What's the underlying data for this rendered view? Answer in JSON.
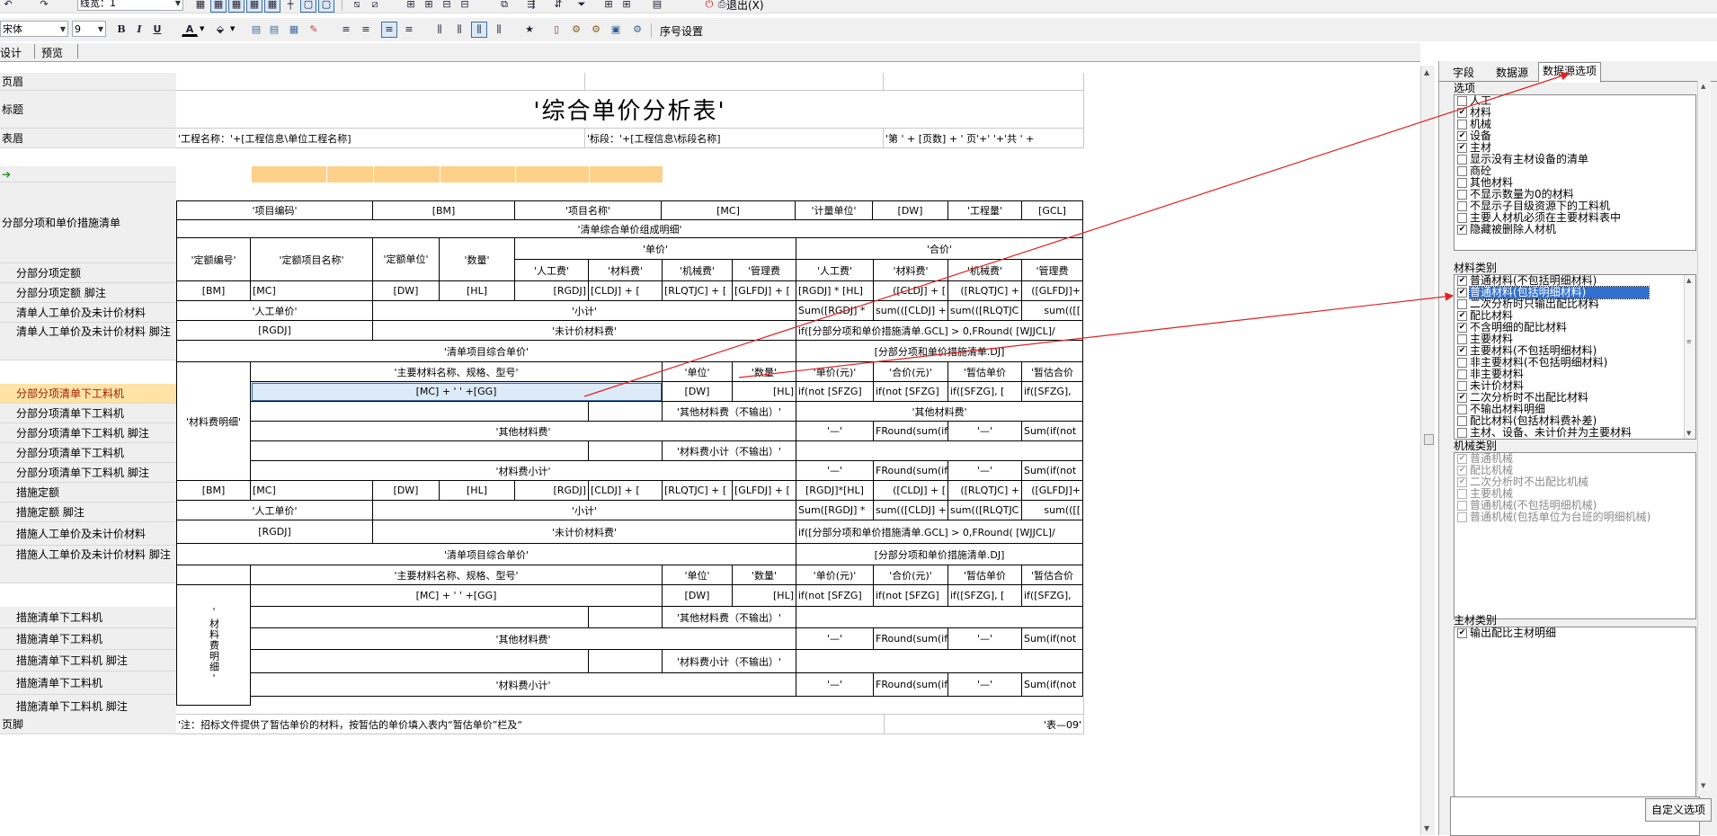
{
  "toolbar1": {
    "line_width": "线宽：1",
    "exit_label": "退出(X)"
  },
  "toolbar2": {
    "font_name": "宋体",
    "font_size": "9",
    "bold": "B",
    "italic": "I",
    "underline": "U",
    "font_color": "A",
    "star": "★",
    "serial_settings": "序号设置"
  },
  "view_tabs": [
    "设计",
    "预览"
  ],
  "sections": {
    "page_header": "页眉",
    "title": "标题",
    "table_header": "表眉",
    "page_footer": "页脚",
    "rows": [
      "分部分项和单价措施清单",
      "分部分项定额",
      "分部分项定额 脚注",
      "清单人工单价及未计价材料",
      "清单人工单价及未计价材料 脚注",
      "分部分项清单下工料机",
      "分部分项清单下工料机",
      "分部分项清单下工料机 脚注",
      "分部分项清单下工料机",
      "分部分项清单下工料机 脚注",
      "措施定额",
      "措施定额 脚注",
      "措施人工单价及未计价材料",
      "措施人工单价及未计价材料 脚注",
      "措施清单下工料机",
      "措施清单下工料机",
      "措施清单下工料机 脚注",
      "措施清单下工料机",
      "措施清单下工料机 脚注"
    ]
  },
  "report": {
    "title": "'综合单价分析表'",
    "project_name": "'工程名称：'+[工程信息\\单位工程名称]",
    "section_name": "'标段：'+[工程信息\\标段名称]",
    "page_info": "'第 ' + [页数] + ' 页'+' '+'共 ' +",
    "hdr": {
      "item_code": "'项目编码'",
      "bm": "[BM]",
      "item_name": "'项目名称'",
      "mc": "[MC]",
      "unit": "'计量单位'",
      "dw": "[DW]",
      "qty": "'工程量'",
      "gcl": "[GCL]",
      "composition": "'清单综合单价组成明细'",
      "quota_no": "'定额编号'",
      "quota_name": "'定额项目名称'",
      "quota_unit": "'定额单位'",
      "amount": "'数量'",
      "unit_price": "'单价'",
      "total_price": "'合价'",
      "labor": "'人工费'",
      "material": "'材料费'",
      "machine": "'机械费'",
      "mgmt": "'管理费",
      "labor2": "'人工费'",
      "material2": "'材料费'",
      "machine2": "'机械费'",
      "mgmt2": "'管理费"
    },
    "quota_row": [
      "[BM]",
      "[MC]",
      "[DW]",
      "[HL]",
      "[RGDJ]",
      "[CLDJ] + [",
      "[RLQTJC] + [",
      "[GLFDJ] + [",
      "[RGDJ] * [HL]",
      "([CLDJ] + [",
      "([RLQTJC] +",
      "([GLFDJ]+"
    ],
    "labor_unit": "'人工单价'",
    "subtotal": "'小计'",
    "sum_row": [
      "Sum([RGDJ] *",
      "sum(([CLDJ] +",
      "sum(([RLQTJC",
      "sum(([["
    ],
    "rgdj": "[RGDJ]",
    "unpriced_material": "'未计价材料费'",
    "unpriced_formula": "if([分部分项和单价措施清单.GCL] > 0,FRound( [WJJCL]/",
    "item_total": "'清单项目综合单价'",
    "item_total_formula": "[分部分项和单价措施清单.DJ]",
    "material_detail": "'材料费明细'",
    "mat_hdr": [
      "'主要材料名称、规格、型号'",
      "'单位'",
      "'数量'",
      "'单价(元)'",
      "'合价(元)'",
      "'暂估单价",
      "'暂估合价"
    ],
    "mat_row": [
      "[MC] + ' ' +[GG]",
      "[DW]",
      "[HL]",
      "if(not [SFZG]",
      "if(not [SFZG]",
      "if([SFZG], [",
      "if([SFZG],"
    ],
    "other_mat_noout": "'其他材料费（不输出）'",
    "other_mat": "'其他材料费'",
    "other_mat_label": "'其他材料费'",
    "dash": "'—'",
    "fround": "FRound(sum(if",
    "sum_if": "Sum(if(not",
    "mat_subtotal_noout": "'材料费小计（不输出）'",
    "mat_subtotal": "'材料费小计'",
    "quota_row2": [
      "[BM]",
      "[MC]",
      "[DW]",
      "[HL]",
      "[RGDJ]",
      "[CLDJ] + [",
      "[RLQTJC] + [",
      "[GLFDJ] + [",
      "[RGDJ]*[HL]",
      "([CLDJ] + [",
      "([RLQTJC] +",
      "([GLFDJ]+"
    ],
    "mat_detail_vert": "'材料费明细'",
    "footer_note": "'注：招标文件提供了暂估单价的材料，按暂估的单价填入表内“暂估单价”栏及“",
    "footer_table_no": "'表—09'"
  },
  "panel": {
    "tabs": [
      "字段",
      "数据源",
      "数据源选项"
    ],
    "active_tab": "数据源选项",
    "options_title": "选项",
    "options": [
      {
        "label": "人工",
        "checked": false
      },
      {
        "label": "材料",
        "checked": true
      },
      {
        "label": "机械",
        "checked": false
      },
      {
        "label": "设备",
        "checked": true
      },
      {
        "label": "主材",
        "checked": true
      },
      {
        "label": "显示没有主材设备的清单",
        "checked": false
      },
      {
        "label": "商砼",
        "checked": false
      },
      {
        "label": "其他材料",
        "checked": false
      },
      {
        "label": "不显示数量为0的材料",
        "checked": false
      },
      {
        "label": "不显示子目级资源下的工料机",
        "checked": false
      },
      {
        "label": "主要人材机必须在主要材料表中",
        "checked": false
      },
      {
        "label": "隐藏被删除人材机",
        "checked": true
      }
    ],
    "material_title": "材料类别",
    "materials": [
      {
        "label": "普通材料(不包括明细材料)",
        "checked": true
      },
      {
        "label": "普通材料(包括明细材料)",
        "checked": true,
        "selected": true
      },
      {
        "label": "二次分析时只输出配比材料",
        "checked": false
      },
      {
        "label": "配比材料",
        "checked": true
      },
      {
        "label": "不含明细的配比材料",
        "checked": true
      },
      {
        "label": "主要材料",
        "checked": false
      },
      {
        "label": "主要材料(不包括明细材料)",
        "checked": true
      },
      {
        "label": "非主要材料(不包括明细材料)",
        "checked": false
      },
      {
        "label": "非主要材料",
        "checked": false
      },
      {
        "label": "未计价材料",
        "checked": false
      },
      {
        "label": "二次分析时不出配比材料",
        "checked": true
      },
      {
        "label": "不输出材料明细",
        "checked": false
      },
      {
        "label": "配比材料(包括材料费补差)",
        "checked": false
      },
      {
        "label": "主材、设备、未计价并为主要材料",
        "checked": false
      }
    ],
    "machine_title": "机械类别",
    "machines": [
      {
        "label": "普通机械",
        "checked": true
      },
      {
        "label": "配比机械",
        "checked": true
      },
      {
        "label": "二次分析时不出配比机械",
        "checked": true
      },
      {
        "label": "主要机械",
        "checked": false
      },
      {
        "label": "普通机械(不包括明细机械)",
        "checked": false
      },
      {
        "label": "普通机械(包括单位为台班的明细机械)",
        "checked": false
      }
    ],
    "main_mat_title": "主材类别",
    "main_mats": [
      {
        "label": "输出配比主材明细",
        "checked": true
      }
    ],
    "custom_button": "自定义选项"
  },
  "colors": {
    "accent": "#3070d0",
    "highlight_row": "#ffe3a6",
    "header_band": "#ffd08a",
    "arrow": "#e02020"
  }
}
